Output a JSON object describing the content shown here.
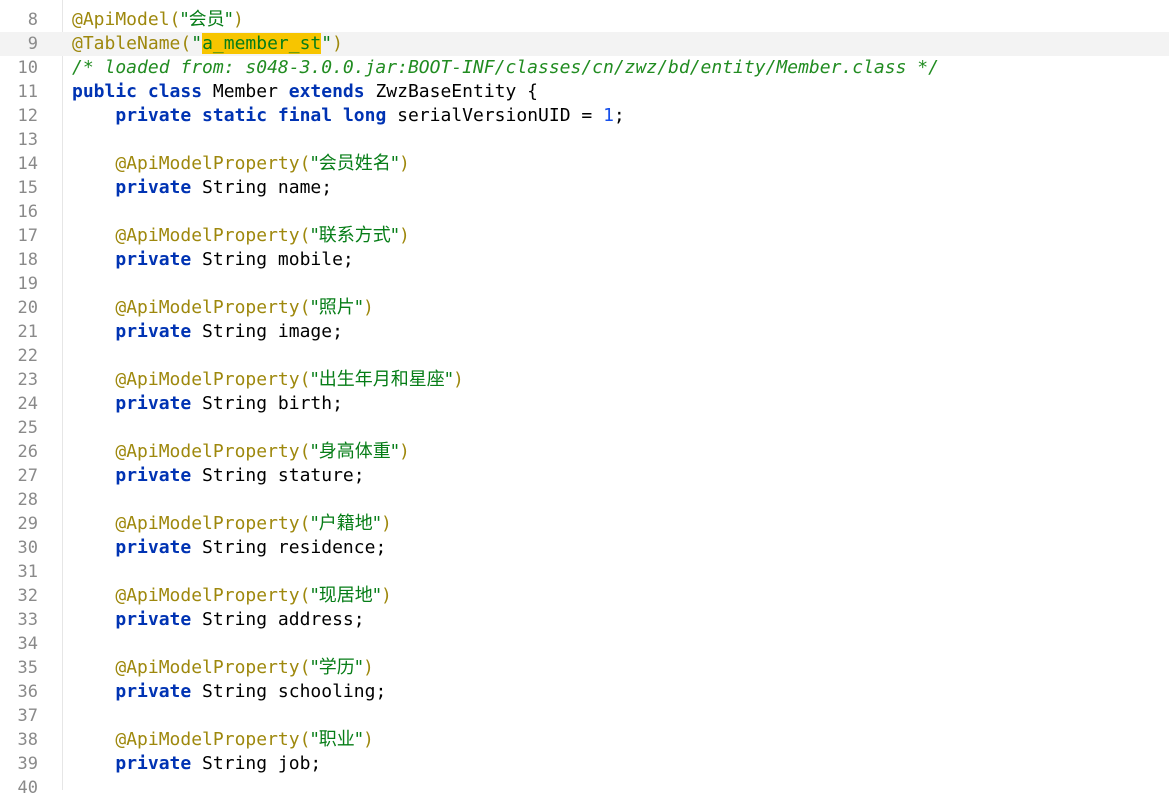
{
  "editor": {
    "partial_top_line_number": "7",
    "partial_bottom_line_number": "40",
    "lines": [
      {
        "num": "8",
        "tokens": [
          {
            "t": "ann",
            "v": "@ApiModel("
          },
          {
            "t": "str",
            "v": "\"会员\""
          },
          {
            "t": "ann",
            "v": ")"
          }
        ]
      },
      {
        "num": "9",
        "current": true,
        "tokens": [
          {
            "t": "ann",
            "v": "@TableName("
          },
          {
            "t": "str",
            "v": "\""
          },
          {
            "t": "caret",
            "v": ""
          },
          {
            "t": "strhl",
            "v": "a_member_st"
          },
          {
            "t": "str",
            "v": "\""
          },
          {
            "t": "ann",
            "v": ")"
          }
        ]
      },
      {
        "num": "10",
        "tokens": [
          {
            "t": "cm",
            "v": "/* loaded from: s048-3.0.0.jar:BOOT-INF/classes/cn/zwz/bd/entity/Member.class */"
          }
        ]
      },
      {
        "num": "11",
        "tokens": [
          {
            "t": "kw",
            "v": "public class"
          },
          {
            "t": "plain",
            "v": " Member "
          },
          {
            "t": "kw",
            "v": "extends"
          },
          {
            "t": "plain",
            "v": " ZwzBaseEntity {"
          }
        ]
      },
      {
        "num": "12",
        "tokens": [
          {
            "t": "plain",
            "v": "    "
          },
          {
            "t": "kw",
            "v": "private static final"
          },
          {
            "t": "plain",
            "v": " "
          },
          {
            "t": "prim",
            "v": "long"
          },
          {
            "t": "plain",
            "v": " serialVersionUID = "
          },
          {
            "t": "num",
            "v": "1"
          },
          {
            "t": "plain",
            "v": ";"
          }
        ]
      },
      {
        "num": "13",
        "tokens": []
      },
      {
        "num": "14",
        "tokens": [
          {
            "t": "plain",
            "v": "    "
          },
          {
            "t": "ann",
            "v": "@ApiModelProperty("
          },
          {
            "t": "str",
            "v": "\"会员姓名\""
          },
          {
            "t": "ann",
            "v": ")"
          }
        ]
      },
      {
        "num": "15",
        "tokens": [
          {
            "t": "plain",
            "v": "    "
          },
          {
            "t": "kw",
            "v": "private"
          },
          {
            "t": "plain",
            "v": " String name;"
          }
        ]
      },
      {
        "num": "16",
        "tokens": []
      },
      {
        "num": "17",
        "tokens": [
          {
            "t": "plain",
            "v": "    "
          },
          {
            "t": "ann",
            "v": "@ApiModelProperty("
          },
          {
            "t": "str",
            "v": "\"联系方式\""
          },
          {
            "t": "ann",
            "v": ")"
          }
        ]
      },
      {
        "num": "18",
        "tokens": [
          {
            "t": "plain",
            "v": "    "
          },
          {
            "t": "kw",
            "v": "private"
          },
          {
            "t": "plain",
            "v": " String mobile;"
          }
        ]
      },
      {
        "num": "19",
        "tokens": []
      },
      {
        "num": "20",
        "tokens": [
          {
            "t": "plain",
            "v": "    "
          },
          {
            "t": "ann",
            "v": "@ApiModelProperty("
          },
          {
            "t": "str",
            "v": "\"照片\""
          },
          {
            "t": "ann",
            "v": ")"
          }
        ]
      },
      {
        "num": "21",
        "tokens": [
          {
            "t": "plain",
            "v": "    "
          },
          {
            "t": "kw",
            "v": "private"
          },
          {
            "t": "plain",
            "v": " String image;"
          }
        ]
      },
      {
        "num": "22",
        "tokens": []
      },
      {
        "num": "23",
        "tokens": [
          {
            "t": "plain",
            "v": "    "
          },
          {
            "t": "ann",
            "v": "@ApiModelProperty("
          },
          {
            "t": "str",
            "v": "\"出生年月和星座\""
          },
          {
            "t": "ann",
            "v": ")"
          }
        ]
      },
      {
        "num": "24",
        "tokens": [
          {
            "t": "plain",
            "v": "    "
          },
          {
            "t": "kw",
            "v": "private"
          },
          {
            "t": "plain",
            "v": " String birth;"
          }
        ]
      },
      {
        "num": "25",
        "tokens": []
      },
      {
        "num": "26",
        "tokens": [
          {
            "t": "plain",
            "v": "    "
          },
          {
            "t": "ann",
            "v": "@ApiModelProperty("
          },
          {
            "t": "str",
            "v": "\"身高体重\""
          },
          {
            "t": "ann",
            "v": ")"
          }
        ]
      },
      {
        "num": "27",
        "tokens": [
          {
            "t": "plain",
            "v": "    "
          },
          {
            "t": "kw",
            "v": "private"
          },
          {
            "t": "plain",
            "v": " String stature;"
          }
        ]
      },
      {
        "num": "28",
        "tokens": []
      },
      {
        "num": "29",
        "tokens": [
          {
            "t": "plain",
            "v": "    "
          },
          {
            "t": "ann",
            "v": "@ApiModelProperty("
          },
          {
            "t": "str",
            "v": "\"户籍地\""
          },
          {
            "t": "ann",
            "v": ")"
          }
        ]
      },
      {
        "num": "30",
        "tokens": [
          {
            "t": "plain",
            "v": "    "
          },
          {
            "t": "kw",
            "v": "private"
          },
          {
            "t": "plain",
            "v": " String residence;"
          }
        ]
      },
      {
        "num": "31",
        "tokens": []
      },
      {
        "num": "32",
        "tokens": [
          {
            "t": "plain",
            "v": "    "
          },
          {
            "t": "ann",
            "v": "@ApiModelProperty("
          },
          {
            "t": "str",
            "v": "\"现居地\""
          },
          {
            "t": "ann",
            "v": ")"
          }
        ]
      },
      {
        "num": "33",
        "tokens": [
          {
            "t": "plain",
            "v": "    "
          },
          {
            "t": "kw",
            "v": "private"
          },
          {
            "t": "plain",
            "v": " String address;"
          }
        ]
      },
      {
        "num": "34",
        "tokens": []
      },
      {
        "num": "35",
        "tokens": [
          {
            "t": "plain",
            "v": "    "
          },
          {
            "t": "ann",
            "v": "@ApiModelProperty("
          },
          {
            "t": "str",
            "v": "\"学历\""
          },
          {
            "t": "ann",
            "v": ")"
          }
        ]
      },
      {
        "num": "36",
        "tokens": [
          {
            "t": "plain",
            "v": "    "
          },
          {
            "t": "kw",
            "v": "private"
          },
          {
            "t": "plain",
            "v": " String schooling;"
          }
        ]
      },
      {
        "num": "37",
        "tokens": []
      },
      {
        "num": "38",
        "tokens": [
          {
            "t": "plain",
            "v": "    "
          },
          {
            "t": "ann",
            "v": "@ApiModelProperty("
          },
          {
            "t": "str",
            "v": "\"职业\""
          },
          {
            "t": "ann",
            "v": ")"
          }
        ]
      },
      {
        "num": "39",
        "tokens": [
          {
            "t": "plain",
            "v": "    "
          },
          {
            "t": "kw",
            "v": "private"
          },
          {
            "t": "plain",
            "v": " String job;"
          }
        ]
      }
    ]
  },
  "colors": {
    "annotation": "#9e880d",
    "string": "#067d17",
    "keyword": "#0033b3",
    "number": "#1750eb",
    "comment": "#218c21",
    "highlight": "#f7c500",
    "current_line": "#f3f3f3",
    "line_number": "#8a8a8a"
  }
}
